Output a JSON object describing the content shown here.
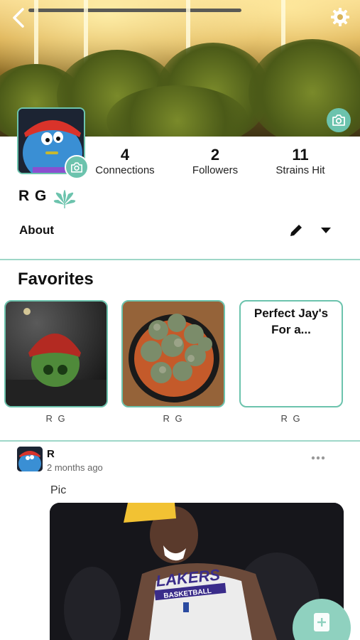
{
  "profile": {
    "name": "R G",
    "stats": [
      {
        "value": "4",
        "label": "Connections"
      },
      {
        "value": "2",
        "label": "Followers"
      },
      {
        "value": "11",
        "label": "Strains Hit"
      }
    ],
    "about_label": "About"
  },
  "favorites": {
    "title": "Favorites",
    "items": [
      {
        "text": "",
        "user": "R G"
      },
      {
        "text": "",
        "user": "R G"
      },
      {
        "text": "Perfect Jay's For a...",
        "user": "R G"
      }
    ]
  },
  "post": {
    "author": "R",
    "time": "2 months ago",
    "text": "Pic",
    "jersey_line1": "LAKERS",
    "jersey_line2": "BASKETBALL"
  },
  "colors": {
    "accent": "#6cc3ad",
    "divider": "#9ed7c8"
  },
  "icons": [
    "back-icon",
    "gear-icon",
    "camera-icon",
    "leaf-icon",
    "pencil-icon",
    "chevron-down-icon",
    "more-icon",
    "add-post-icon"
  ]
}
